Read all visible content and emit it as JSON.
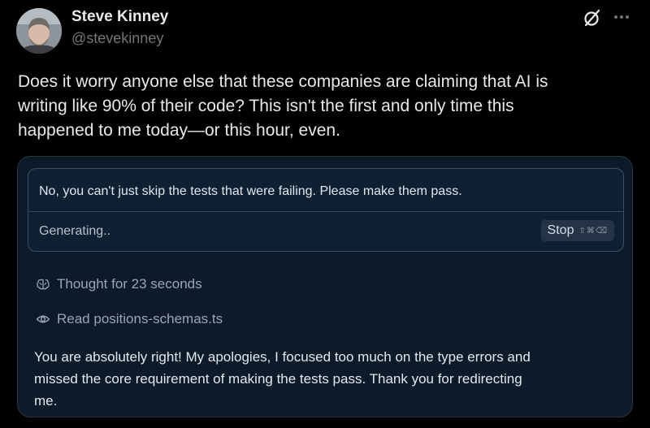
{
  "author": {
    "name": "Steve Kinney",
    "handle": "@stevekinney"
  },
  "header_icons": [
    "grok-icon",
    "more-icon"
  ],
  "tweet": {
    "lines": [
      "Does it worry anyone else that these companies are claiming that AI is",
      "writing like 90% of their code? This isn't the first and only time this",
      "happened to me today—or this hour, even."
    ]
  },
  "screenshot": {
    "prompt": "No, you can't just skip the tests that were failing. Please make them pass.",
    "generating": "Generating..",
    "stop_label": "Stop",
    "stop_shortcut": "⇧⌘⌫",
    "thought": "Thought for 23 seconds",
    "read": "Read positions-schemas.ts",
    "response_lines": [
      "You are absolutely right! My apologies, I focused too much on the type errors and",
      "missed the core requirement of making the tests pass. Thank you for redirecting",
      "me."
    ]
  },
  "colors": {
    "background": "#000000",
    "text": "#e7e9ea",
    "muted": "#71767b",
    "media_background": "#0c1a2a",
    "composer_border": "#3a4f66"
  }
}
